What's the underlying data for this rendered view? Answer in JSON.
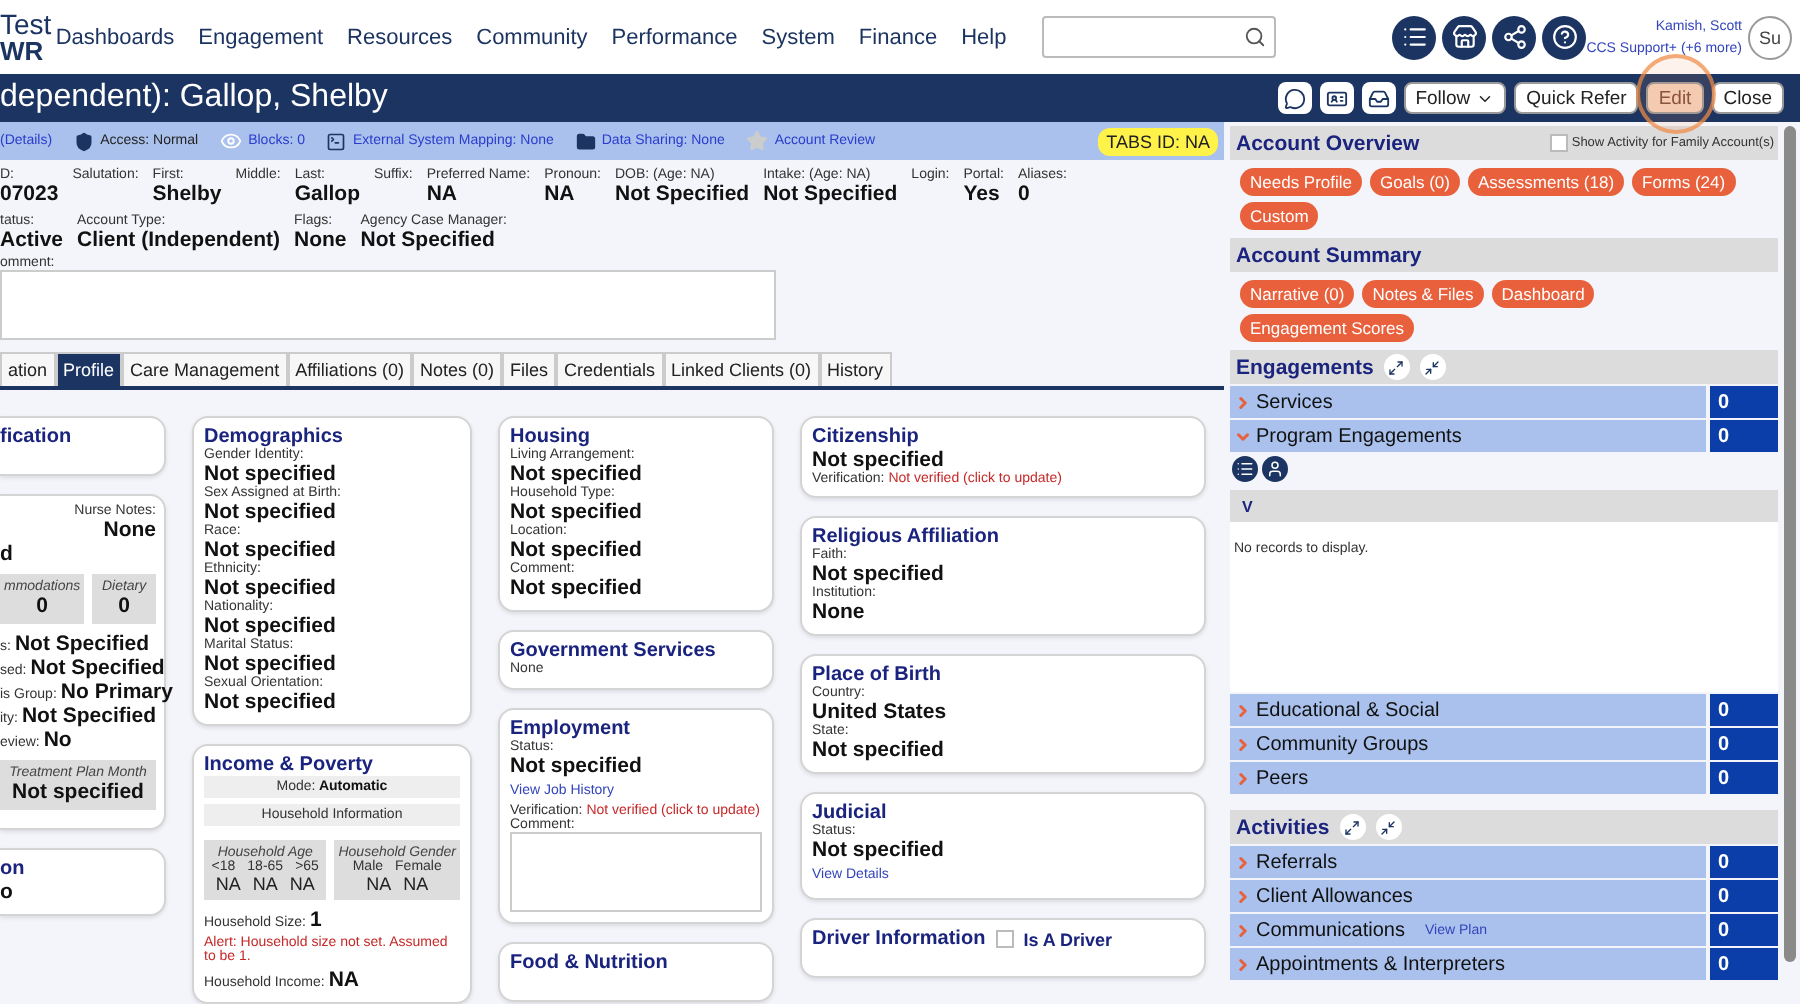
{
  "nav": {
    "logo_top": "Test",
    "logo_bottom": "WR",
    "menu": [
      "Dashboards",
      "Engagement",
      "Resources",
      "Community",
      "Performance",
      "System",
      "Finance",
      "Help"
    ],
    "user": {
      "name": "Kamish, Scott",
      "role": "CCS Support+ (+6 more)",
      "avatar": "Su"
    }
  },
  "title_bar": {
    "title": "dependent): Gallop, Shelby",
    "buttons": [
      {
        "kind": "dropdown",
        "label": "Follow",
        "disabled": false
      },
      {
        "kind": "text",
        "label": "Quick Refer",
        "disabled": false
      },
      {
        "kind": "text",
        "label": "Edit",
        "disabled": true
      },
      {
        "kind": "text",
        "label": "Close",
        "disabled": false
      }
    ]
  },
  "info_strip": {
    "items": [
      {
        "kind": "details",
        "text": "(Details)"
      },
      {
        "kind": "access",
        "text": "Access: Normal"
      },
      {
        "kind": "blocks",
        "text": "Blocks: 0"
      },
      {
        "kind": "mapping",
        "text": "External System Mapping: None"
      },
      {
        "kind": "sharing",
        "text": "Data Sharing: None"
      },
      {
        "kind": "review",
        "text": "Account Review"
      }
    ],
    "badge": "TABS ID: NA"
  },
  "field_rows": [
    [
      {
        "label": "D:",
        "value": "07023"
      },
      {
        "label": "Salutation:"
      },
      {
        "label": "First:",
        "value": "Shelby"
      },
      {
        "label": "Middle:"
      },
      {
        "label": "Last:",
        "value": "Gallop"
      },
      {
        "label": "Suffix:"
      },
      {
        "label": "Preferred Name:",
        "value": "NA"
      },
      {
        "label": "Pronoun:",
        "value": "NA"
      },
      {
        "label": "DOB: (Age: NA)",
        "value": "Not Specified"
      },
      {
        "label": "Intake: (Age: NA)",
        "value": "Not Specified"
      },
      {
        "label": "Login:"
      },
      {
        "label": "Portal:",
        "value": "Yes"
      },
      {
        "label": "Aliases:",
        "value": "0"
      }
    ],
    [
      {
        "label": "tatus:",
        "value": "Active"
      },
      {
        "label": "Account Type:",
        "value": "Client (Independent)"
      },
      {
        "label": "Flags:",
        "value": "None"
      },
      {
        "label": "Agency Case Manager:",
        "value": "Not Specified"
      }
    ]
  ],
  "comment": {
    "label": "omment:"
  },
  "tabs": [
    {
      "label": "ation",
      "selected": false
    },
    {
      "label": "Profile",
      "selected": true
    },
    {
      "label": "Care Management",
      "selected": false
    },
    {
      "label": "Affiliations (0)",
      "selected": false
    },
    {
      "label": "Notes (0)",
      "selected": false
    },
    {
      "label": "Files",
      "selected": false
    },
    {
      "label": "Credentials",
      "selected": false
    },
    {
      "label": "Linked Clients (0)",
      "selected": false
    },
    {
      "label": "History",
      "selected": false
    }
  ],
  "card_columns": [
    [
      {
        "title": "fication"
      },
      {
        "items": [
          {
            "kind": "field_right",
            "label": "Nurse Notes:",
            "value": "None"
          },
          {
            "kind": "value",
            "value": "d"
          },
          {
            "kind": "stat_boxes",
            "boxes": [
              {
                "label": "mmodations",
                "value": "0"
              },
              {
                "label": "Dietary",
                "value": "0"
              }
            ]
          },
          {
            "kind": "inline",
            "label": "s:",
            "value": "Not Specified"
          },
          {
            "kind": "inline",
            "label": "sed:",
            "value": "Not Specified"
          },
          {
            "kind": "inline",
            "label": "is Group:",
            "value": "No Primary"
          },
          {
            "kind": "inline",
            "label": "ity:",
            "value": "Not Specified"
          },
          {
            "kind": "inline",
            "label": "eview:",
            "value": "No"
          },
          {
            "kind": "stat_boxes",
            "boxes": [
              {
                "label": "Treatment Plan Month",
                "value": "Not specified"
              }
            ]
          }
        ]
      },
      {
        "title": "on",
        "items": [
          {
            "kind": "value",
            "value": "o"
          }
        ]
      }
    ],
    [
      {
        "title": "Demographics",
        "items": [
          {
            "kind": "field",
            "label": "Gender Identity:",
            "value": "Not specified"
          },
          {
            "kind": "field",
            "label": "Sex Assigned at Birth:",
            "value": "Not specified"
          },
          {
            "kind": "field",
            "label": "Race:",
            "value": "Not specified"
          },
          {
            "kind": "field",
            "label": "Ethnicity:",
            "value": "Not specified"
          },
          {
            "kind": "field",
            "label": "Nationality:",
            "value": "Not specified"
          },
          {
            "kind": "field",
            "label": "Marital Status:",
            "value": "Not specified"
          },
          {
            "kind": "field",
            "label": "Sexual Orientation:",
            "value": "Not specified"
          }
        ]
      },
      {
        "title": "Income & Poverty",
        "items": [
          {
            "kind": "band",
            "label": "Mode:",
            "value": "Automatic"
          },
          {
            "kind": "band",
            "label": "Household Information"
          },
          {
            "kind": "household",
            "groups": [
              {
                "title": "Household Age",
                "columns": [
                  "<18",
                  "18-65",
                  ">65"
                ],
                "values": [
                  "NA",
                  "NA",
                  "NA"
                ]
              },
              {
                "title": "Household Gender",
                "columns": [
                  "Male",
                  "Female"
                ],
                "values": [
                  "NA",
                  "NA"
                ]
              }
            ]
          },
          {
            "kind": "inline",
            "label": "Household Size:",
            "value": "1"
          },
          {
            "kind": "alert",
            "text": "Alert: Household size not set. Assumed to be 1."
          },
          {
            "kind": "inline",
            "label": "Household Income:",
            "value": "NA"
          }
        ]
      }
    ],
    [
      {
        "title": "Housing",
        "items": [
          {
            "kind": "field",
            "label": "Living Arrangement:",
            "value": "Not specified"
          },
          {
            "kind": "field",
            "label": "Household Type:",
            "value": "Not specified"
          },
          {
            "kind": "field",
            "label": "Location:",
            "value": "Not specified"
          },
          {
            "kind": "field",
            "label": "Comment:",
            "value": "Not specified"
          }
        ]
      },
      {
        "title": "Government Services",
        "items": [
          {
            "kind": "text",
            "text": "None"
          }
        ]
      },
      {
        "title": "Employment",
        "items": [
          {
            "kind": "field",
            "label": "Status:",
            "value": "Not specified"
          },
          {
            "kind": "link",
            "text": "View Job History"
          },
          {
            "kind": "verification",
            "label": "Verification:",
            "value": "Not verified (click to update)"
          },
          {
            "kind": "textarea",
            "label": "Comment:"
          }
        ]
      },
      {
        "title": "Food & Nutrition"
      }
    ],
    [
      {
        "title": "Citizenship",
        "items": [
          {
            "kind": "value",
            "value": "Not specified"
          },
          {
            "kind": "verification",
            "label": "Verification:",
            "value": "Not verified (click to update)"
          }
        ]
      },
      {
        "title": "Religious Affiliation",
        "items": [
          {
            "kind": "field",
            "label": "Faith:",
            "value": "Not specified"
          },
          {
            "kind": "field",
            "label": "Institution:",
            "value": "None"
          }
        ]
      },
      {
        "title": "Place of Birth",
        "items": [
          {
            "kind": "field",
            "label": "Country:",
            "value": "United States"
          },
          {
            "kind": "field",
            "label": "State:",
            "value": "Not specified"
          }
        ]
      },
      {
        "title": "Judicial",
        "items": [
          {
            "kind": "field",
            "label": "Status:",
            "value": "Not specified"
          },
          {
            "kind": "link",
            "text": "View Details"
          }
        ]
      },
      {
        "title": "Driver Information",
        "checkbox": {
          "label": "Is A Driver",
          "checked": false
        }
      }
    ]
  ],
  "overview": {
    "title": "Account Overview",
    "family_toggle": {
      "label": "Show Activity for Family Account(s)",
      "checked": false
    },
    "buttons": [
      "Needs Profile",
      "Goals (0)",
      "Assessments (18)",
      "Forms (24)",
      "Custom"
    ]
  },
  "summary": {
    "title": "Account Summary",
    "buttons": [
      "Narrative (0)",
      "Notes & Files",
      "Dashboard",
      "Engagement Scores"
    ]
  },
  "engagements": {
    "title": "Engagements",
    "rows": [
      {
        "label": "Services",
        "count": "0",
        "expanded": false
      },
      {
        "label": "Program Engagements",
        "count": "0",
        "expanded": true,
        "detail": {
          "header": "V",
          "empty": "No records to display."
        }
      },
      {
        "label": "Educational & Social",
        "count": "0",
        "expanded": false
      },
      {
        "label": "Community Groups",
        "count": "0",
        "expanded": false
      },
      {
        "label": "Peers",
        "count": "0",
        "expanded": false
      }
    ]
  },
  "activities": {
    "title": "Activities",
    "rows": [
      {
        "label": "Referrals",
        "count": "0",
        "expanded": false
      },
      {
        "label": "Client Allowances",
        "count": "0",
        "expanded": false
      },
      {
        "label": "Communications",
        "link": "View Plan",
        "count": "0",
        "expanded": false
      },
      {
        "label": "Appointments & Interpreters",
        "count": "0",
        "expanded": false
      }
    ]
  }
}
